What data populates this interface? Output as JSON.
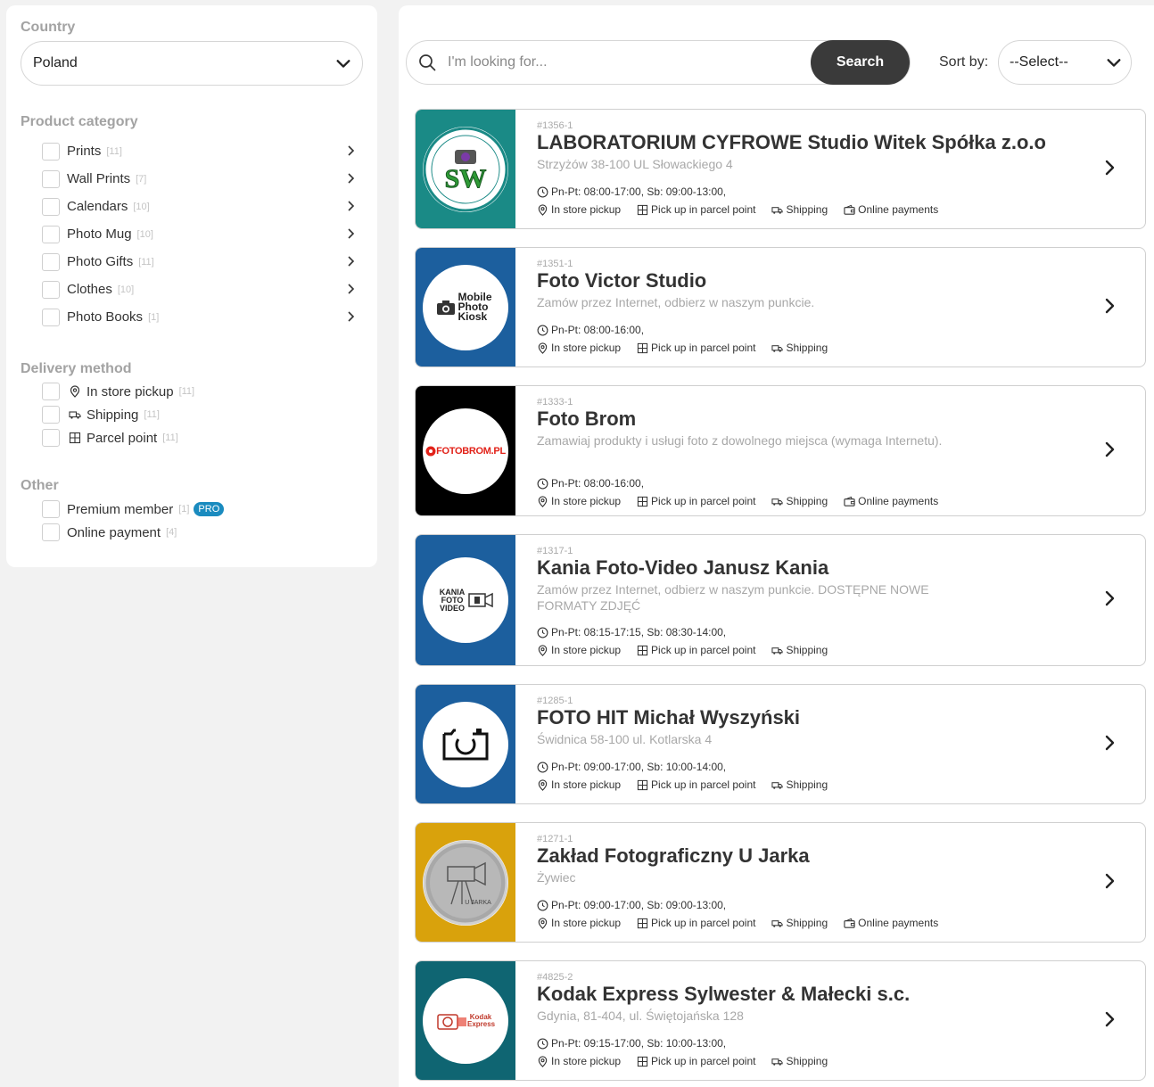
{
  "filters": {
    "country_title": "Country",
    "country_value": "Poland",
    "category_title": "Product category",
    "categories": [
      {
        "label": "Prints",
        "count": "[11]"
      },
      {
        "label": "Wall Prints",
        "count": "[7]"
      },
      {
        "label": "Calendars",
        "count": "[10]"
      },
      {
        "label": "Photo Mug",
        "count": "[10]"
      },
      {
        "label": "Photo Gifts",
        "count": "[11]"
      },
      {
        "label": "Clothes",
        "count": "[10]"
      },
      {
        "label": "Photo Books",
        "count": "[1]"
      }
    ],
    "delivery_title": "Delivery method",
    "delivery": [
      {
        "label": "In store pickup",
        "count": "[11]",
        "icon": "map-pin-icon"
      },
      {
        "label": "Shipping",
        "count": "[11]",
        "icon": "truck-icon"
      },
      {
        "label": "Parcel point",
        "count": "[11]",
        "icon": "parcel-grid-icon"
      }
    ],
    "other_title": "Other",
    "other": [
      {
        "label": "Premium member",
        "count": "[1]",
        "badge": "PRO"
      },
      {
        "label": "Online payment",
        "count": "[4]"
      }
    ]
  },
  "search": {
    "placeholder": "I'm looking for...",
    "button": "Search"
  },
  "sort": {
    "label": "Sort by:",
    "value": "--Select--"
  },
  "features_labels": {
    "pickup": "In store pickup",
    "parcel": "Pick up in parcel point",
    "shipping": "Shipping",
    "online": "Online payments"
  },
  "stores": [
    {
      "id": "#1356-1",
      "name": "LABORATORIUM CYFROWE Studio Witek Spółka z.o.o",
      "desc": "Strzyżów 38-100 UL Słowackiego 4",
      "hours": "Pn-Pt: 08:00-17:00, Sb: 09:00-13:00,",
      "online": true,
      "logo_text": "SW",
      "bg": "#1a8a86"
    },
    {
      "id": "#1351-1",
      "name": "Foto Victor Studio",
      "desc": "Zamów przez Internet, odbierz w naszym punkcie.",
      "hours": "Pn-Pt: 08:00-16:00,",
      "online": false,
      "logo_text": "Mobile Photo Kiosk",
      "bg": "#1c5f9e"
    },
    {
      "id": "#1333-1",
      "name": "Foto Brom",
      "desc": "Zamawiaj produkty i usługi foto z dowolnego miejsca (wymaga Internetu).",
      "hours": "Pn-Pt: 08:00-16:00,",
      "online": true,
      "logo_text": "FOTOBROM.PL",
      "bg": "#000000"
    },
    {
      "id": "#1317-1",
      "name": "Kania Foto-Video Janusz Kania",
      "desc": "Zamów przez Internet, odbierz w naszym punkcie. DOSTĘPNE NOWE FORMATY ZDJĘĆ",
      "hours": "Pn-Pt: 08:15-17:15, Sb: 08:30-14:00,",
      "online": false,
      "logo_text": "KANIA FOTO VIDEO",
      "bg": "#1c5f9e"
    },
    {
      "id": "#1285-1",
      "name": "FOTO HIT Michał Wyszyński",
      "desc": "Świdnica 58-100 ul. Kotlarska 4",
      "hours": "Pn-Pt: 09:00-17:00, Sb: 10:00-14:00,",
      "online": false,
      "logo_text": "",
      "bg": "#1c5f9e"
    },
    {
      "id": "#1271-1",
      "name": "Zakład Fotograficzny U Jarka",
      "desc": "Żywiec",
      "hours": "Pn-Pt: 09:00-17:00, Sb: 09:00-13:00,",
      "online": true,
      "logo_text": "U JARKA",
      "bg": "#d9a20c"
    },
    {
      "id": "#4825-2",
      "name": "Kodak Express Sylwester & Małecki s.c.",
      "desc": "Gdynia, 81-404, ul. Świętojańska 128",
      "hours": "Pn-Pt: 09:15-17:00, Sb: 10:00-13:00,",
      "online": false,
      "logo_text": "Kodak Express",
      "bg": "#0f6572"
    }
  ],
  "colors": {
    "accent_dark": "#3a3a3a",
    "pro_badge": "#1a8bbf"
  }
}
